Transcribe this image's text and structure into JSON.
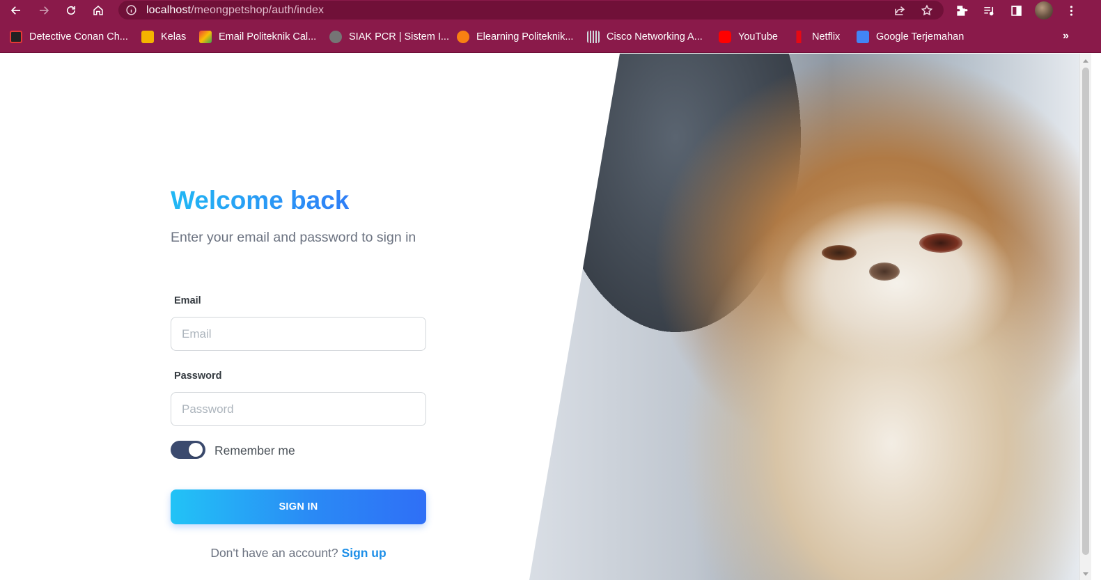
{
  "browser": {
    "url_host": "localhost",
    "url_path": "/meongpetshop/auth/index",
    "bookmarks": [
      {
        "label": "Detective Conan Ch...",
        "color": "#e53935"
      },
      {
        "label": "Kelas",
        "color": "#f4b400"
      },
      {
        "label": "Email Politeknik Cal...",
        "color": "#ea4335"
      },
      {
        "label": "SIAK PCR | Sistem I...",
        "color": "#9e9e9e"
      },
      {
        "label": "Elearning Politeknik...",
        "color": "#f98012"
      },
      {
        "label": "Cisco Networking A...",
        "color": "#cfd8dc"
      },
      {
        "label": "YouTube",
        "color": "#ff0000"
      },
      {
        "label": "Netflix",
        "color": "#e50914"
      },
      {
        "label": "Google Terjemahan",
        "color": "#4285f4"
      }
    ],
    "more_label": "»"
  },
  "login": {
    "title": "Welcome back",
    "subtitle": "Enter your email and password to sign in",
    "email_label": "Email",
    "email_placeholder": "Email",
    "password_label": "Password",
    "password_placeholder": "Password",
    "remember_label": "Remember me",
    "remember_checked": true,
    "signin_label": "SIGN IN",
    "no_account_text": "Don't have an account?",
    "signup_label": "Sign up"
  },
  "colors": {
    "browser_frame": "#8a1a4a",
    "title_gradient_start": "#21b8f4",
    "title_gradient_end": "#2f7ef6",
    "toggle_on": "#3b4a6e",
    "link": "#1d8fe8"
  }
}
